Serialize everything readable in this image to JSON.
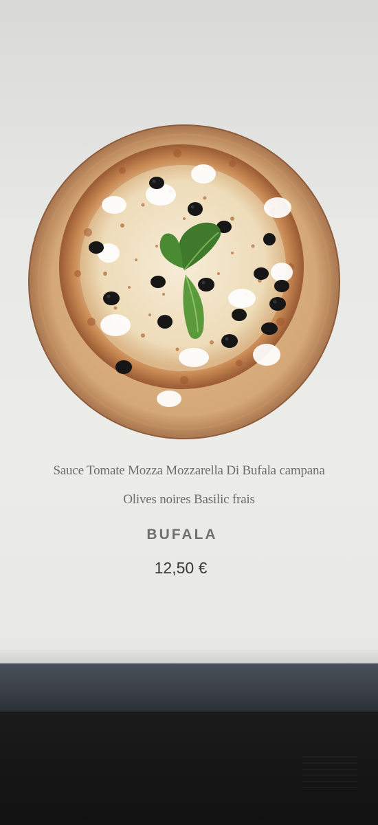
{
  "product": {
    "image_name": "pizza-image",
    "description_line1": "Sauce Tomate Mozza Mozzarella Di Bufala campana",
    "description_line2": "Olives noires Basilic frais",
    "name": "BUFALA",
    "price": "12,50 €"
  },
  "colors": {
    "screen_background": "#e8e8e6",
    "description_text": "#6d6d6d",
    "name_text": "#707070",
    "price_text": "#383838",
    "bezel": "#3b4049",
    "desk": "#151515"
  }
}
